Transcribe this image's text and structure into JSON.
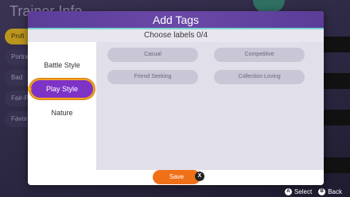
{
  "background": {
    "title": "Trainer Info",
    "side_tabs": [
      "Profi",
      "Portra",
      "Bad",
      "Fair-P",
      "Favor"
    ]
  },
  "modal": {
    "title": "Add Tags",
    "subtitle": "Choose labels 0/4",
    "categories": [
      "Battle Style",
      "Play Style",
      "Nature"
    ],
    "selected_category": "Play Style",
    "tags": [
      "Casual",
      "Competitive",
      "Friend Seeking",
      "Collection Loving"
    ],
    "save_label": "Save",
    "save_shortcut": "X"
  },
  "hints": [
    {
      "button": "A",
      "label": "Select"
    },
    {
      "button": "B",
      "label": "Back"
    }
  ],
  "colors": {
    "header": "#5b3d98",
    "accent": "#7ad4d0",
    "active_category": "#7e33c7",
    "save_button": "#f07018"
  }
}
